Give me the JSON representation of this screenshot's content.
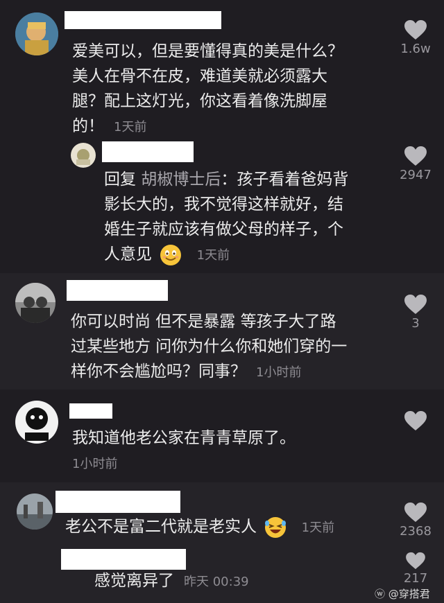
{
  "comments": [
    {
      "text": "爱美可以，但是要懂得真的美是什么？美人在骨不在皮，难道美就必须露大腿？配上这灯光，你这看着像洗脚屋的！",
      "lines": [
        "爱美可以，但是要懂得真的美是什么？",
        "美人在骨不在皮，难道美就必须露大",
        "腿？配上这灯光，你这看着像洗脚屋",
        "的！"
      ],
      "time": "1天前",
      "likes": "1.6w",
      "reply": {
        "prefix": "回复",
        "reply_to": "胡椒博士后",
        "lines": [
          "：孩子看着爸妈背",
          "影长大的，我不觉得这样就好，结",
          "婚生子就应该有做父母的样子，个",
          "人意见"
        ],
        "time": "1天前",
        "likes": "2947"
      }
    },
    {
      "lines": [
        "你可以时尚 但不是暴露 等孩子大了路",
        "过某些地方 问你为什么你和她们穿的一",
        "样你不会尴尬吗？同事？"
      ],
      "time": "1小时前",
      "likes": "3"
    },
    {
      "lines": [
        "我知道他老公家在青青草原了。"
      ],
      "time": "1小时前",
      "likes": ""
    },
    {
      "lines": [
        "老公不是富二代就是老实人"
      ],
      "time": "1天前",
      "likes": "2368",
      "reply": {
        "lines": [
          "感觉离异了"
        ],
        "time": "昨天 00:39",
        "likes": "217"
      }
    }
  ],
  "watermark": {
    "text": "@穿搭君"
  },
  "colors": {
    "panel_bg": "#1f1d22",
    "alt_panel_bg": "#262428",
    "text": "#ececec",
    "muted": "#8e8c92",
    "heart": "#b9b8bc"
  }
}
